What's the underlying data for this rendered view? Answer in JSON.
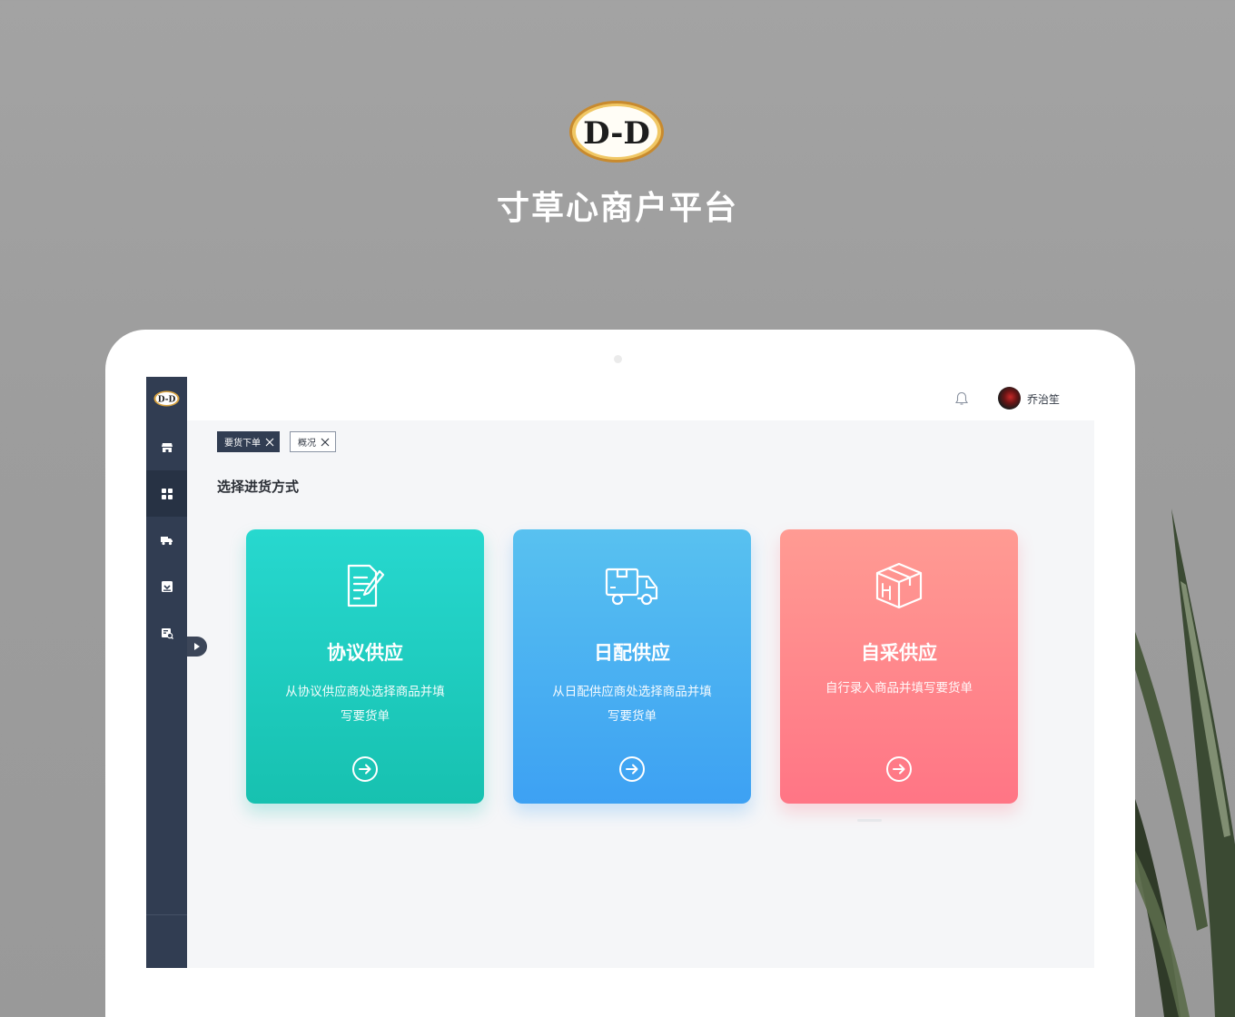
{
  "hero": {
    "logo_text": "D-D",
    "title": "寸草心商户平台"
  },
  "sidebar": {
    "logo_text": "D-D",
    "items": [
      {
        "icon": "store-icon",
        "active": false
      },
      {
        "icon": "grid-icon",
        "active": true
      },
      {
        "icon": "truck-icon",
        "active": false
      },
      {
        "icon": "inbox-icon",
        "active": false
      },
      {
        "icon": "report-icon",
        "active": false
      }
    ]
  },
  "topbar": {
    "user_name": "乔治笙"
  },
  "tabs": [
    {
      "label": "要货下单",
      "active": true
    },
    {
      "label": "概况",
      "active": false
    }
  ],
  "main": {
    "section_title": "选择进货方式",
    "cards": [
      {
        "title": "协议供应",
        "desc": "从协议供应商处选择商品并填写要货单",
        "icon": "document-edit-icon"
      },
      {
        "title": "日配供应",
        "desc": "从日配供应商处选择商品并填写要货单",
        "icon": "delivery-truck-icon"
      },
      {
        "title": "自采供应",
        "desc": "自行录入商品并填写要货单",
        "icon": "package-box-icon"
      }
    ]
  },
  "colors": {
    "sidebar": "#313d52",
    "card_teal": "#17c1b0",
    "card_blue": "#3da1f3",
    "card_pink": "#ff7585"
  }
}
